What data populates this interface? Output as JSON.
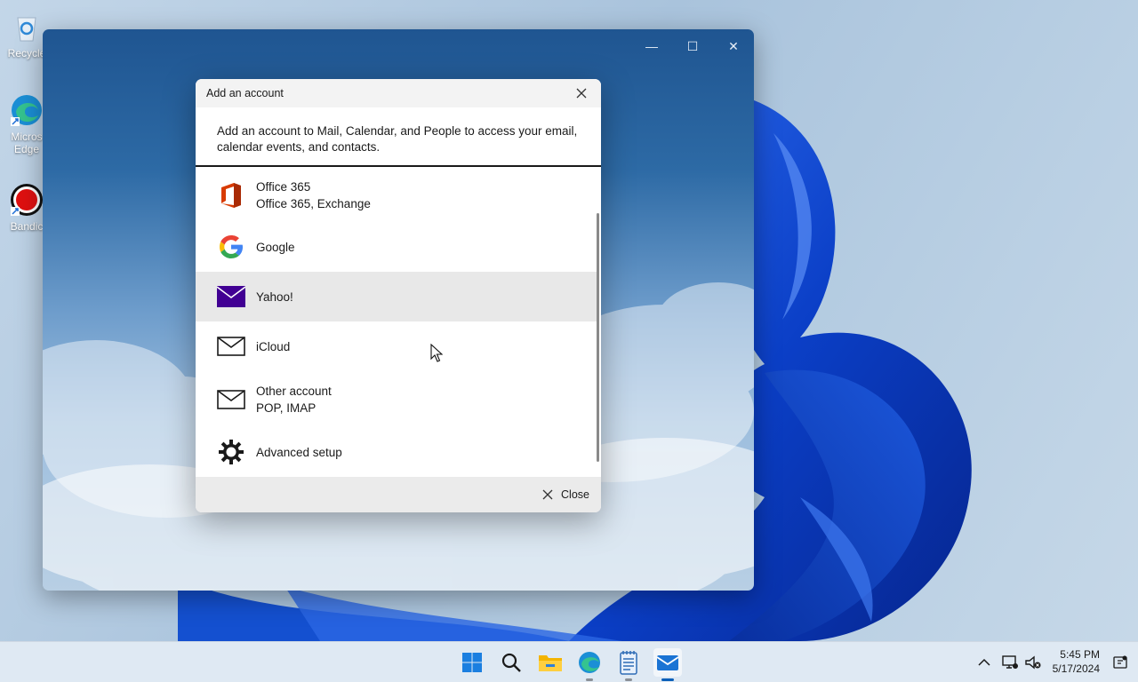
{
  "desktop": {
    "icons": [
      {
        "label": "Recycle",
        "icon": "recycle-bin-icon"
      },
      {
        "label": "Micros",
        "label2": "Edge",
        "icon": "edge-icon"
      },
      {
        "label": "Bandic",
        "icon": "bandicam-icon"
      }
    ]
  },
  "app_window": {
    "controls": {
      "minimize": "—",
      "maximize": "☐",
      "close": "✕"
    }
  },
  "dialog": {
    "title": "Add an account",
    "intro": "Add an account to Mail, Calendar, and People to access your email, calendar events, and contacts.",
    "providers": [
      {
        "name": "Office 365",
        "subtitle": "Office 365, Exchange",
        "icon": "office365-icon"
      },
      {
        "name": "Google",
        "subtitle": "",
        "icon": "google-icon"
      },
      {
        "name": "Yahoo!",
        "subtitle": "",
        "icon": "yahoo-mail-icon"
      },
      {
        "name": "iCloud",
        "subtitle": "",
        "icon": "mail-envelope-icon"
      },
      {
        "name": "Other account",
        "subtitle": "POP, IMAP",
        "icon": "mail-envelope-icon"
      },
      {
        "name": "Advanced setup",
        "subtitle": "",
        "icon": "gear-icon"
      }
    ],
    "footer_close": "Close"
  },
  "taskbar": {
    "apps": [
      "start-icon",
      "search-icon",
      "file-explorer-icon",
      "edge-icon",
      "notepad-icon",
      "mail-icon"
    ],
    "time": "5:45 PM",
    "date": "5/17/2024"
  },
  "colors": {
    "accent": "#0a5fb8",
    "yahoo": "#410093",
    "office_red": "#d83b01"
  }
}
